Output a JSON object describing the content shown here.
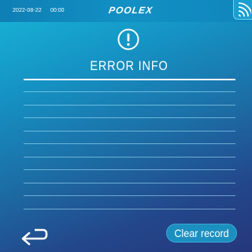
{
  "status_bar": {
    "date": "2022-08-22",
    "time": "00:00",
    "brand": "POOLEX",
    "wifi_icon": "wifi-icon"
  },
  "header": {
    "icon": "error-circle-icon",
    "title": "ERROR INFO"
  },
  "error_records": [
    {
      "text": ""
    },
    {
      "text": ""
    },
    {
      "text": ""
    },
    {
      "text": ""
    },
    {
      "text": ""
    },
    {
      "text": ""
    },
    {
      "text": ""
    },
    {
      "text": ""
    },
    {
      "text": ""
    },
    {
      "text": ""
    }
  ],
  "footer": {
    "back_icon": "return-arrow-icon",
    "clear_label": "Clear record"
  },
  "colors": {
    "background_top": "#18b6d8",
    "background_bottom": "#26377c",
    "button": "#1b8fc0",
    "text": "#ffffff"
  }
}
